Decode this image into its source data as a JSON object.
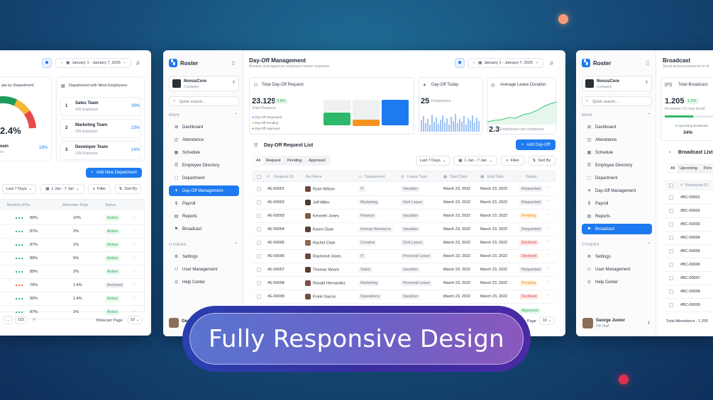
{
  "banner": {
    "title": "Fully Responsive Design"
  },
  "left_screen": {
    "panel_title_partial": "ate by Department",
    "gauge_value": "2.4%",
    "gauge_label": "eam",
    "gauge_label2": "ce",
    "gauge_pct": "18%",
    "most_employees_title": "Department with Most Employees",
    "teams": [
      {
        "rank": "1",
        "name": "Sales Team",
        "count": "439 Employee",
        "pct": "39%"
      },
      {
        "rank": "2",
        "name": "Marketing Team",
        "count": "209 Employee",
        "pct": "23%"
      },
      {
        "rank": "3",
        "name": "Developer Team",
        "count": "139 Employee",
        "pct": "14%"
      }
    ],
    "add_department_label": "Add New Department",
    "date_range": "January 1 - January 7, 2025",
    "filter_range": "Last 7 Days",
    "filter_date": "1 Jan - 7 Jan",
    "filter_label": "Filter",
    "sort_label": "Sort By",
    "columns": [
      "Monthly KPIs",
      "Absentee Rate",
      "Status"
    ],
    "rows": [
      {
        "kpi": "90%",
        "absentee": "10%",
        "status": "Active"
      },
      {
        "kpi": "87%",
        "absentee": "2%",
        "status": "Active"
      },
      {
        "kpi": "87%",
        "absentee": "1%",
        "status": "Active"
      },
      {
        "kpi": "89%",
        "absentee": "5%",
        "status": "Active"
      },
      {
        "kpi": "89%",
        "absentee": "2%",
        "status": "Active"
      },
      {
        "kpi": "79%",
        "absentee": "1.4%",
        "status": "Archived"
      },
      {
        "kpi": "90%",
        "absentee": "1.4%",
        "status": "Active"
      },
      {
        "kpi": "87%",
        "absentee": "1%",
        "status": "Active"
      }
    ],
    "page_dots": "...",
    "page_last": "102",
    "show_per_page": "Show per Page",
    "per_page": "10"
  },
  "center_screen": {
    "app_name": "Roster",
    "company_name": "NovusCore",
    "company_sub": "Company",
    "search_placeholder": "Quick search...",
    "main_label": "MAIN",
    "others_label": "OTHERS",
    "nav": [
      "Dashboard",
      "Attendance",
      "Schedule",
      "Employee Directory",
      "Department",
      "Day-Off Management",
      "Payroll",
      "Reports",
      "Broadcast"
    ],
    "others_nav": [
      "Settings",
      "User Management",
      "Help Center"
    ],
    "user_partial": "Geo",
    "page_title": "Day-Off Management",
    "page_subtitle": "Review and approve employee leave requests.",
    "date_range": "January 1 - January 7, 2025",
    "card_total_title": "Total Day-Off Request",
    "total_value": "23.129",
    "total_delta": "3.8%",
    "total_label": "Total Request",
    "legend": [
      "Day-Off Requested",
      "Day-Off Pending",
      "Day-Off Approved"
    ],
    "card_today_title": "Day-Off Today",
    "today_value": "25",
    "today_label": "Employees",
    "card_avg_title": "Average Leave Duration",
    "avg_value": "2.3",
    "avg_label": "Employees per employee",
    "list_title": "Day-Off Request List",
    "add_button": "Add Day-Off",
    "tabs": [
      "All",
      "Request",
      "Pending",
      "Approved"
    ],
    "filter_range": "Last 7 Days",
    "filter_date": "1 Jan - 7 Jan",
    "filter_label": "Filter",
    "sort_label": "Sort By",
    "columns": [
      "Request ID",
      "Name",
      "Department",
      "Leave Type",
      "Start Date",
      "End Date",
      "Status"
    ],
    "rows": [
      {
        "id": "#E-00001",
        "name": "Ryan Wilson",
        "dept": "IT",
        "type": "Vacation",
        "start": "March 23, 2022",
        "end": "March 23, 2022",
        "status": "Requested"
      },
      {
        "id": "#E-00002",
        "name": "Jeff Miller",
        "dept": "Marketing",
        "type": "Sick Leave",
        "start": "March 23, 2022",
        "end": "March 23, 2022",
        "status": "Requested"
      },
      {
        "id": "#E-00003",
        "name": "Kenneth Jones",
        "dept": "Finance",
        "type": "Vacation",
        "start": "March 23, 2022",
        "end": "March 23, 2022",
        "status": "Pending"
      },
      {
        "id": "#E-00004",
        "name": "Karen Clark",
        "dept": "Human Resource",
        "type": "Vacation",
        "start": "March 23, 2022",
        "end": "March 23, 2022",
        "status": "Requested"
      },
      {
        "id": "#E-00005",
        "name": "Rachel Clark",
        "dept": "Creative",
        "type": "Sick Leave",
        "start": "March 23, 2022",
        "end": "March 23, 2022",
        "status": "Declined"
      },
      {
        "id": "#E-00006",
        "name": "Raymond Jones",
        "dept": "IT",
        "type": "Personal Leave",
        "start": "March 23, 2022",
        "end": "March 23, 2022",
        "status": "Declined"
      },
      {
        "id": "#E-00007",
        "name": "Thomas Moore",
        "dept": "Sales",
        "type": "Vacation",
        "start": "March 23, 2022",
        "end": "March 23, 2022",
        "status": "Requested"
      },
      {
        "id": "#E-00008",
        "name": "Ronald Hernandez",
        "dept": "Marketing",
        "type": "Personal Leave",
        "start": "March 23, 2022",
        "end": "March 23, 2022",
        "status": "Pending"
      },
      {
        "id": "#E-00009",
        "name": "Frank Garcia",
        "dept": "Operations",
        "type": "Vacation",
        "start": "March 23, 2022",
        "end": "March 23, 2022",
        "status": "Declined"
      }
    ],
    "extra_status": "Approved",
    "page_partial": "Page",
    "per_page": "10"
  },
  "right_screen": {
    "app_name": "Roster",
    "company_name": "NovusCore",
    "company_sub": "Company",
    "search_placeholder": "Quick search...",
    "main_label": "MAIN",
    "others_label": "OTHERS",
    "nav": [
      "Dashboard",
      "Attendance",
      "Schedule",
      "Employee Directory",
      "Department",
      "Day-Off Management",
      "Payroll",
      "Reports",
      "Broadcast"
    ],
    "others_nav": [
      "Settings",
      "User Management",
      "Help Center"
    ],
    "user_name": "George Junior",
    "user_role": "HR Staff",
    "page_title": "Broadcast",
    "page_subtitle": "Send announcements to th",
    "total_title": "Total Broadcast",
    "total_value": "1.205",
    "total_delta": "1.2%",
    "total_note": "Increased +12 new broad",
    "upcoming_label": "Upcoming Broadcast",
    "upcoming_pct": "34%",
    "list_title": "Broadcast List",
    "tabs": [
      "All",
      "Upcoming",
      "Perv"
    ],
    "column": "Broadcast ID",
    "ids": [
      "#BC-00001",
      "#BC-00002",
      "#BC-00003",
      "#BC-00004",
      "#BC-00005",
      "#BC-00006",
      "#BC-00007",
      "#BC-00008",
      "#BC-00009"
    ],
    "footer": "Total Attendance : 1.205"
  }
}
